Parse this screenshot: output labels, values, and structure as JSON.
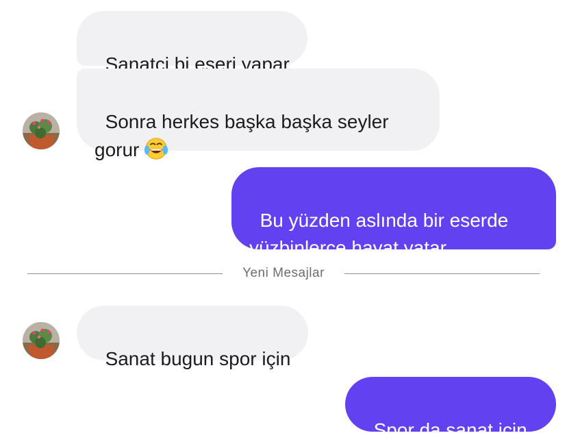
{
  "messages": [
    {
      "text": "Sanatçi bi eseri yapar"
    },
    {
      "text": "Sonra herkes başka başka seyler\ngorur",
      "emoji": "face-with-tears-of-joy-icon"
    },
    {
      "text": "Bu yüzden aslında bir eserde\nyüzbinlerce hayat yatar."
    },
    {
      "text": "Sanat bugun spor için"
    },
    {
      "text": "Spor da sanat için"
    }
  ],
  "divider": {
    "label": "Yeni Mesajlar"
  },
  "colors": {
    "outgoing": "#6242f0",
    "incoming": "#f1f1f4"
  }
}
